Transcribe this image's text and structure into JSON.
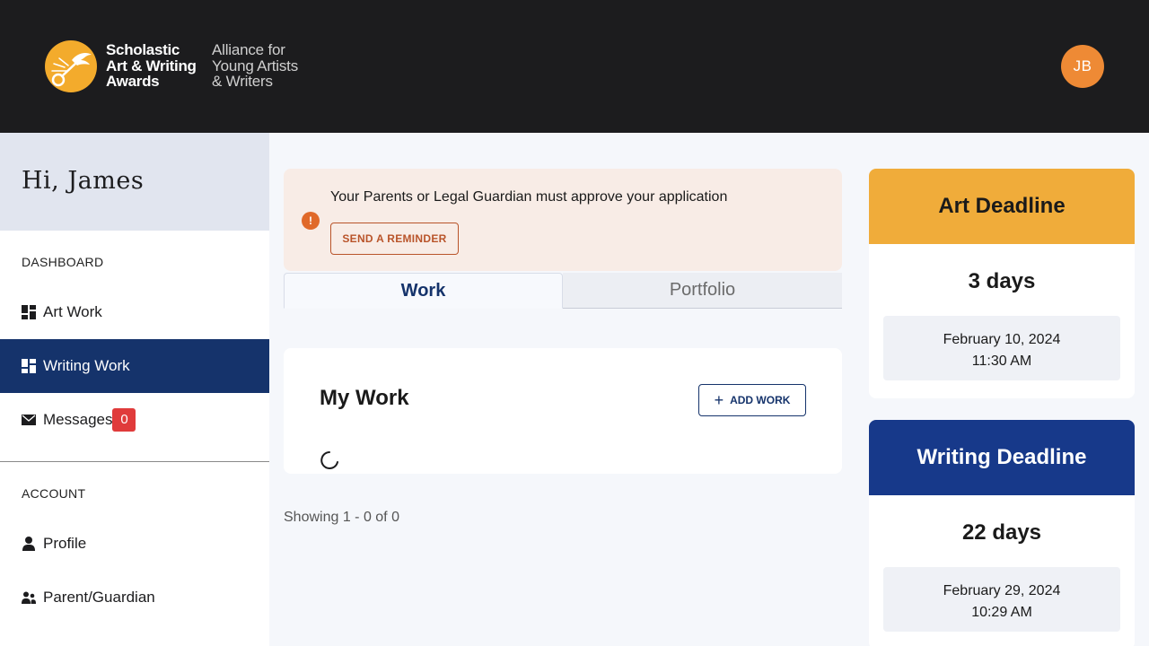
{
  "header": {
    "logo_main": [
      "Scholastic",
      "Art & Writing",
      "Awards"
    ],
    "logo_sub": [
      "Alliance for",
      "Young Artists",
      "& Writers"
    ],
    "avatar_initials": "JB"
  },
  "sidebar": {
    "greeting": "Hi, James",
    "dashboard_label": "DASHBOARD",
    "dashboard_items": [
      {
        "label": "Art Work",
        "icon": "grid-icon"
      },
      {
        "label": "Writing Work",
        "icon": "grid-icon",
        "active": true
      },
      {
        "label": "Messages",
        "icon": "envelope-icon",
        "badge": "0"
      }
    ],
    "account_label": "ACCOUNT",
    "account_items": [
      {
        "label": "Profile",
        "icon": "person-icon"
      },
      {
        "label": "Parent/Guardian",
        "icon": "people-icon"
      }
    ]
  },
  "alert": {
    "message": "Your Parents or Legal Guardian must approve your application",
    "button": "SEND A REMINDER"
  },
  "tabs": [
    {
      "label": "Work",
      "active": true
    },
    {
      "label": "Portfolio",
      "active": false
    }
  ],
  "work": {
    "title": "My Work",
    "add_button": "ADD WORK",
    "showing": "Showing 1 - 0 of 0"
  },
  "deadlines": [
    {
      "title": "Art Deadline",
      "days": "3 days",
      "date": "February 10, 2024",
      "time": "11:30 AM",
      "color": "#f0ac3a"
    },
    {
      "title": "Writing Deadline",
      "days": "22 days",
      "date": "February 29, 2024",
      "time": "10:29 AM",
      "color": "#17398a"
    }
  ],
  "colors": {
    "header_bg": "#1c1c1e",
    "brand_gold": "#f3ab2c",
    "nav_active": "#15336b",
    "alert_bg": "#f8ece6",
    "alert_accent": "#e0692a",
    "avatar_bg": "#ee8a35"
  }
}
